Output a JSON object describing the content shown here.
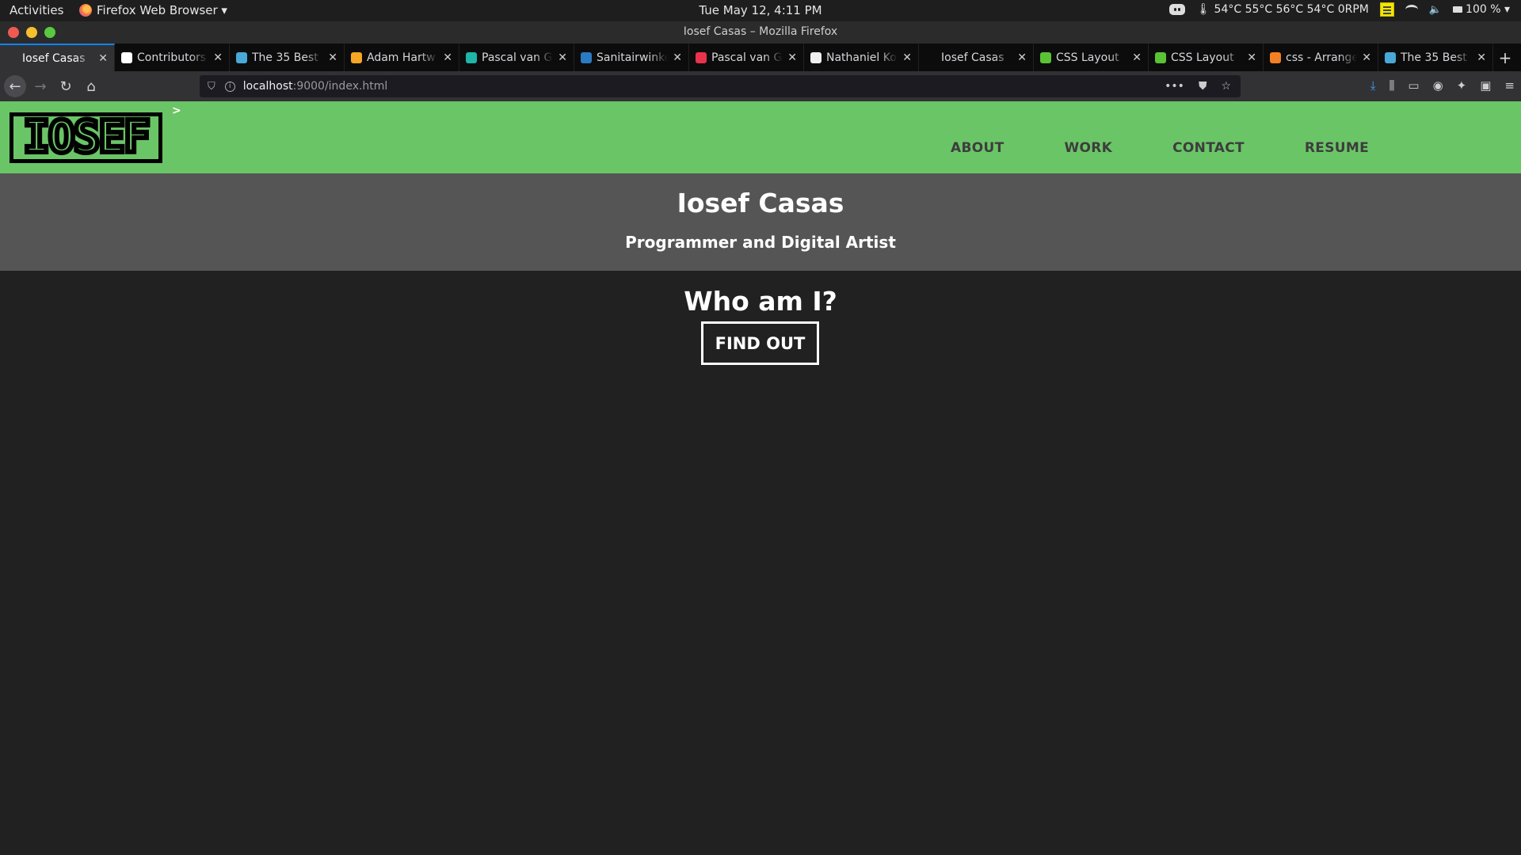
{
  "system_bar": {
    "activities": "Activities",
    "app_menu": "Firefox Web Browser ▾",
    "clock": "Tue May 12,  4:11 PM",
    "temps": "54°C 55°C 56°C 54°C 0RPM",
    "battery": "100 % ▾"
  },
  "window": {
    "title": "Iosef Casas – Mozilla Firefox"
  },
  "tabs": [
    {
      "label": "Iosef Casas",
      "fav": "#323234",
      "active": true
    },
    {
      "label": "Contributors",
      "fav": "#ffffff"
    },
    {
      "label": "The 35 Best",
      "fav": "#4aa8d8"
    },
    {
      "label": "Adam Hartw",
      "fav": "#f5a623"
    },
    {
      "label": "Pascal van G",
      "fav": "#1fb5a8"
    },
    {
      "label": "Sanitairwinkel",
      "fav": "#2a7bc4"
    },
    {
      "label": "Pascal van G",
      "fav": "#e8334a"
    },
    {
      "label": "Nathaniel Ko",
      "fav": "#eeeeee"
    },
    {
      "label": "Iosef Casas",
      "fav": "#0c0c0d"
    },
    {
      "label": "CSS Layout",
      "fav": "#5bc236"
    },
    {
      "label": "CSS Layout",
      "fav": "#5bc236"
    },
    {
      "label": "css - Arrange",
      "fav": "#f48024"
    },
    {
      "label": "The 35 Best",
      "fav": "#4aa8d8"
    }
  ],
  "urlbar": {
    "host": "localhost",
    "rest": ":9000/index.html"
  },
  "site": {
    "logo_text": "IOSEF",
    "arrow": ">",
    "nav": [
      "ABOUT",
      "WORK",
      "CONTACT",
      "RESUME"
    ],
    "name": "Iosef Casas",
    "tagline": "Programmer and Digital Artist",
    "who_heading": "Who am I?",
    "cta": "FIND OUT"
  }
}
